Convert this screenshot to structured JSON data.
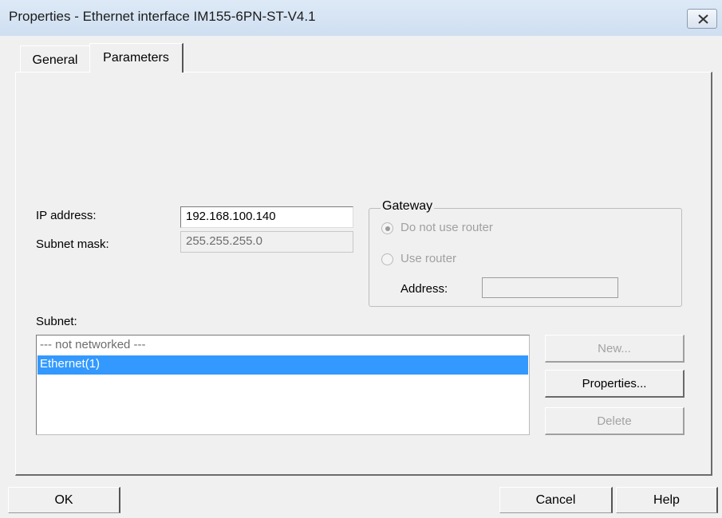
{
  "window": {
    "title": "Properties - Ethernet interface  IM155-6PN-ST-V4.1",
    "close_icon": "close-icon"
  },
  "tabs": [
    {
      "label": "General",
      "active": false
    },
    {
      "label": "Parameters",
      "active": true
    }
  ],
  "ip": {
    "label": "IP address:",
    "value": "192.168.100.140"
  },
  "subnet_mask": {
    "label": "Subnet mask:",
    "value": "255.255.255.0"
  },
  "gateway": {
    "title": "Gateway",
    "options": [
      {
        "label": "Do not use router",
        "selected": true,
        "enabled": false
      },
      {
        "label": "Use router",
        "selected": false,
        "enabled": false
      }
    ],
    "address_label": "Address:",
    "address_value": ""
  },
  "subnet": {
    "label": "Subnet:",
    "items": [
      {
        "label": "--- not networked ---",
        "selected": false
      },
      {
        "label": "Ethernet(1)",
        "selected": true
      }
    ],
    "buttons": {
      "new": {
        "label": "New...",
        "enabled": false
      },
      "properties": {
        "label": "Properties...",
        "enabled": true
      },
      "delete": {
        "label": "Delete",
        "enabled": false
      }
    }
  },
  "footer": {
    "ok": "OK",
    "cancel": "Cancel",
    "help": "Help"
  },
  "colors": {
    "selection": "#3399ff",
    "dialog_bg": "#f0f0f0",
    "titlebar": "#d6e4f3"
  }
}
